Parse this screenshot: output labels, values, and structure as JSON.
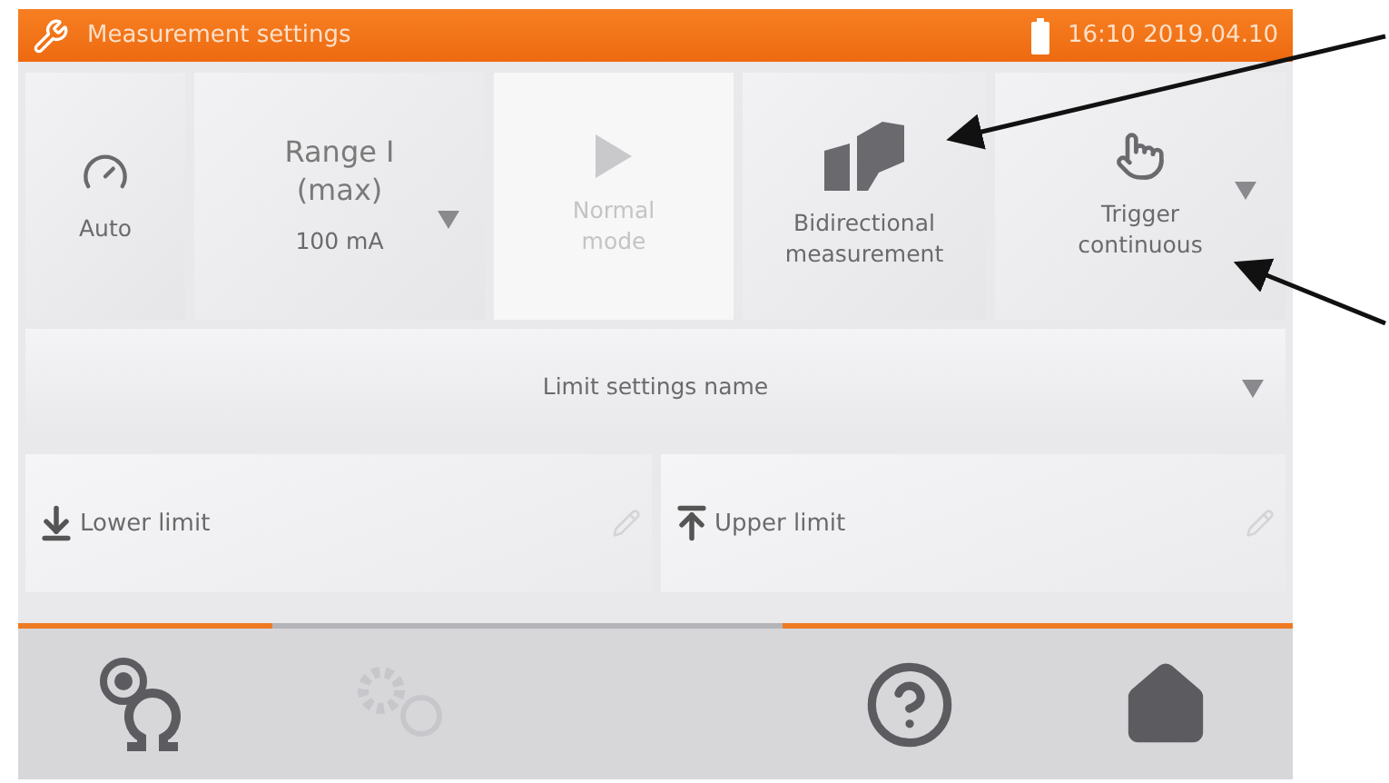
{
  "header": {
    "title": "Measurement settings",
    "datetime": "16:10 2019.04.10"
  },
  "tiles": [
    {
      "kind": "auto",
      "label": "Auto",
      "disabled": false
    },
    {
      "kind": "range",
      "title": "Range I\n(max)",
      "value": "100 mA",
      "disabled": false
    },
    {
      "kind": "play",
      "label": "Normal\nmode",
      "disabled": true
    },
    {
      "kind": "bidirectional",
      "label": "Bidirectional\nmeasurement",
      "disabled": false
    },
    {
      "kind": "trigger",
      "label": "Trigger\ncontinuous",
      "disabled": false
    }
  ],
  "limit_name": {
    "label": "Limit settings name"
  },
  "limits": [
    {
      "kind": "lower",
      "label": "Lower limit"
    },
    {
      "kind": "upper",
      "label": "Upper limit"
    }
  ],
  "footer": [
    {
      "kind": "measure",
      "active": true,
      "disabled": false
    },
    {
      "kind": "settings",
      "active": false,
      "disabled": true
    },
    {
      "kind": "gap",
      "active": false
    },
    {
      "kind": "help",
      "active": true,
      "disabled": false
    },
    {
      "kind": "home",
      "active": true,
      "disabled": false
    }
  ]
}
